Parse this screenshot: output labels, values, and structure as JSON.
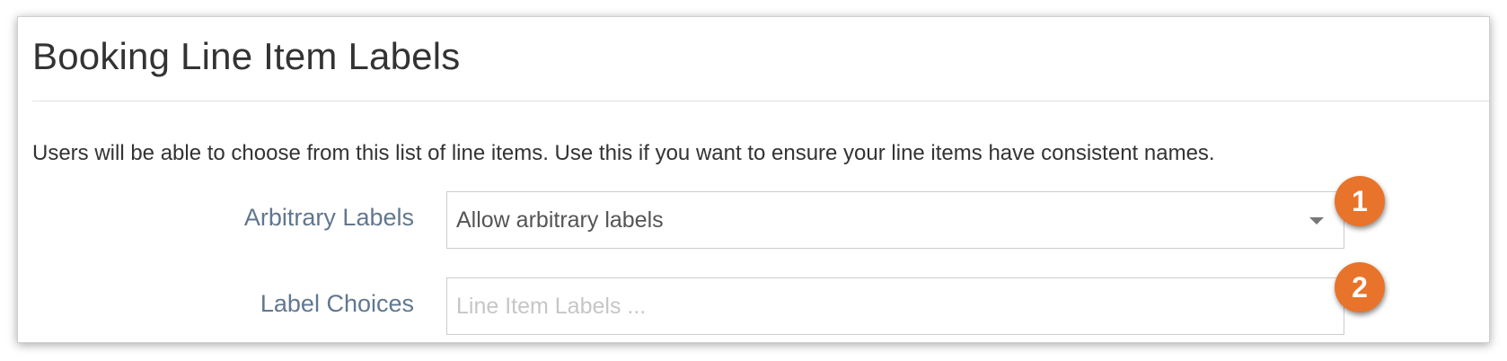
{
  "section": {
    "title": "Booking Line Item Labels",
    "description": "Users will be able to choose from this list of line items. Use this if you want to ensure your line items have consistent names."
  },
  "fields": {
    "arbitrary_labels": {
      "label": "Arbitrary Labels",
      "selected_value": "Allow arbitrary labels",
      "icon": "chevron-down-icon"
    },
    "label_choices": {
      "label": "Label Choices",
      "value": "",
      "placeholder": "Line Item Labels ..."
    }
  },
  "callouts": [
    {
      "number": "1",
      "color": "#e8732a"
    },
    {
      "number": "2",
      "color": "#e8732a"
    }
  ],
  "colors": {
    "field_label": "#61778f",
    "callout": "#e8732a",
    "text": "#333333"
  }
}
